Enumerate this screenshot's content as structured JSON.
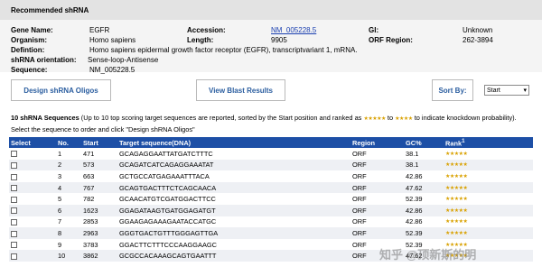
{
  "section_title": "Recommended shRNA",
  "info": {
    "gene_name_label": "Gene Name:",
    "gene_name": "EGFR",
    "accession_label": "Accession:",
    "accession": "NM_005228.5",
    "gi_label": "GI:",
    "gi": "Unknown",
    "organism_label": "Organism:",
    "organism": "Homo sapiens",
    "length_label": "Length:",
    "length": "9905",
    "orf_region_label": "ORF Region:",
    "orf_region": "262-3894",
    "definition_label": "Defintion:",
    "definition": "Homo sapiens epidermal growth factor receptor (EGFR), transcriptvariant 1, mRNA.",
    "orientation_label": "shRNA orientation:",
    "orientation": "Sense-loop-Antisense",
    "sequence_label": "Sequence:",
    "sequence": "NM_005228.5"
  },
  "buttons": {
    "design": "Design shRNA Oligos",
    "blast": "View Blast Results",
    "sort_by": "Sort By:",
    "sort_value": "Start"
  },
  "description": {
    "bold": "10 shRNA Sequences",
    "text1": "(Up to 10 top scoring target sequences are reported, sorted by the Start position and ranked as",
    "to": "to",
    "text2": "to indicate knockdown probability). Select the sequence to order and click \"Design shRNA Oligos\"",
    "stars_high": "★★★★★",
    "stars_low": "★★★★"
  },
  "table": {
    "headers": [
      "Select",
      "No.",
      "Start",
      "Target sequence(DNA)",
      "Region",
      "GC%",
      "Rank"
    ],
    "rank_sup": "1",
    "rows": [
      {
        "no": "1",
        "start": "471",
        "seq": "GCAGAGGAATTATGATCTTTC",
        "region": "ORF",
        "gc": "38.1",
        "rank": "★★★★★"
      },
      {
        "no": "2",
        "start": "573",
        "seq": "GCAGATCATCAGAGGAAATAT",
        "region": "ORF",
        "gc": "38.1",
        "rank": "★★★★★"
      },
      {
        "no": "3",
        "start": "663",
        "seq": "GCTGCCATGAGAAATTTACA",
        "region": "ORF",
        "gc": "42.86",
        "rank": "★★★★★"
      },
      {
        "no": "4",
        "start": "767",
        "seq": "GCAGTGACTTTCTCAGCAACA",
        "region": "ORF",
        "gc": "47.62",
        "rank": "★★★★★"
      },
      {
        "no": "5",
        "start": "782",
        "seq": "GCAACATGTCGATGGACTTCC",
        "region": "ORF",
        "gc": "52.39",
        "rank": "★★★★★"
      },
      {
        "no": "6",
        "start": "1623",
        "seq": "GGAGATAAGTGATGGAGATGT",
        "region": "ORF",
        "gc": "42.86",
        "rank": "★★★★★"
      },
      {
        "no": "7",
        "start": "2853",
        "seq": "GGAAGAGAAAGAATACCATGC",
        "region": "ORF",
        "gc": "42.86",
        "rank": "★★★★★"
      },
      {
        "no": "8",
        "start": "2963",
        "seq": "GGGTGACTGTTTGGGAGTTGA",
        "region": "ORF",
        "gc": "52.39",
        "rank": "★★★★★"
      },
      {
        "no": "9",
        "start": "3783",
        "seq": "GGACTTCTTTCCCAAGGAAGC",
        "region": "ORF",
        "gc": "52.39",
        "rank": "★★★★★"
      },
      {
        "no": "10",
        "start": "3862",
        "seq": "GCGCCACAAAGCAGTGAATTT",
        "region": "ORF",
        "gc": "47.62",
        "rank": "★★★★★"
      }
    ]
  },
  "watermark": "知乎 @顶新斯的明"
}
